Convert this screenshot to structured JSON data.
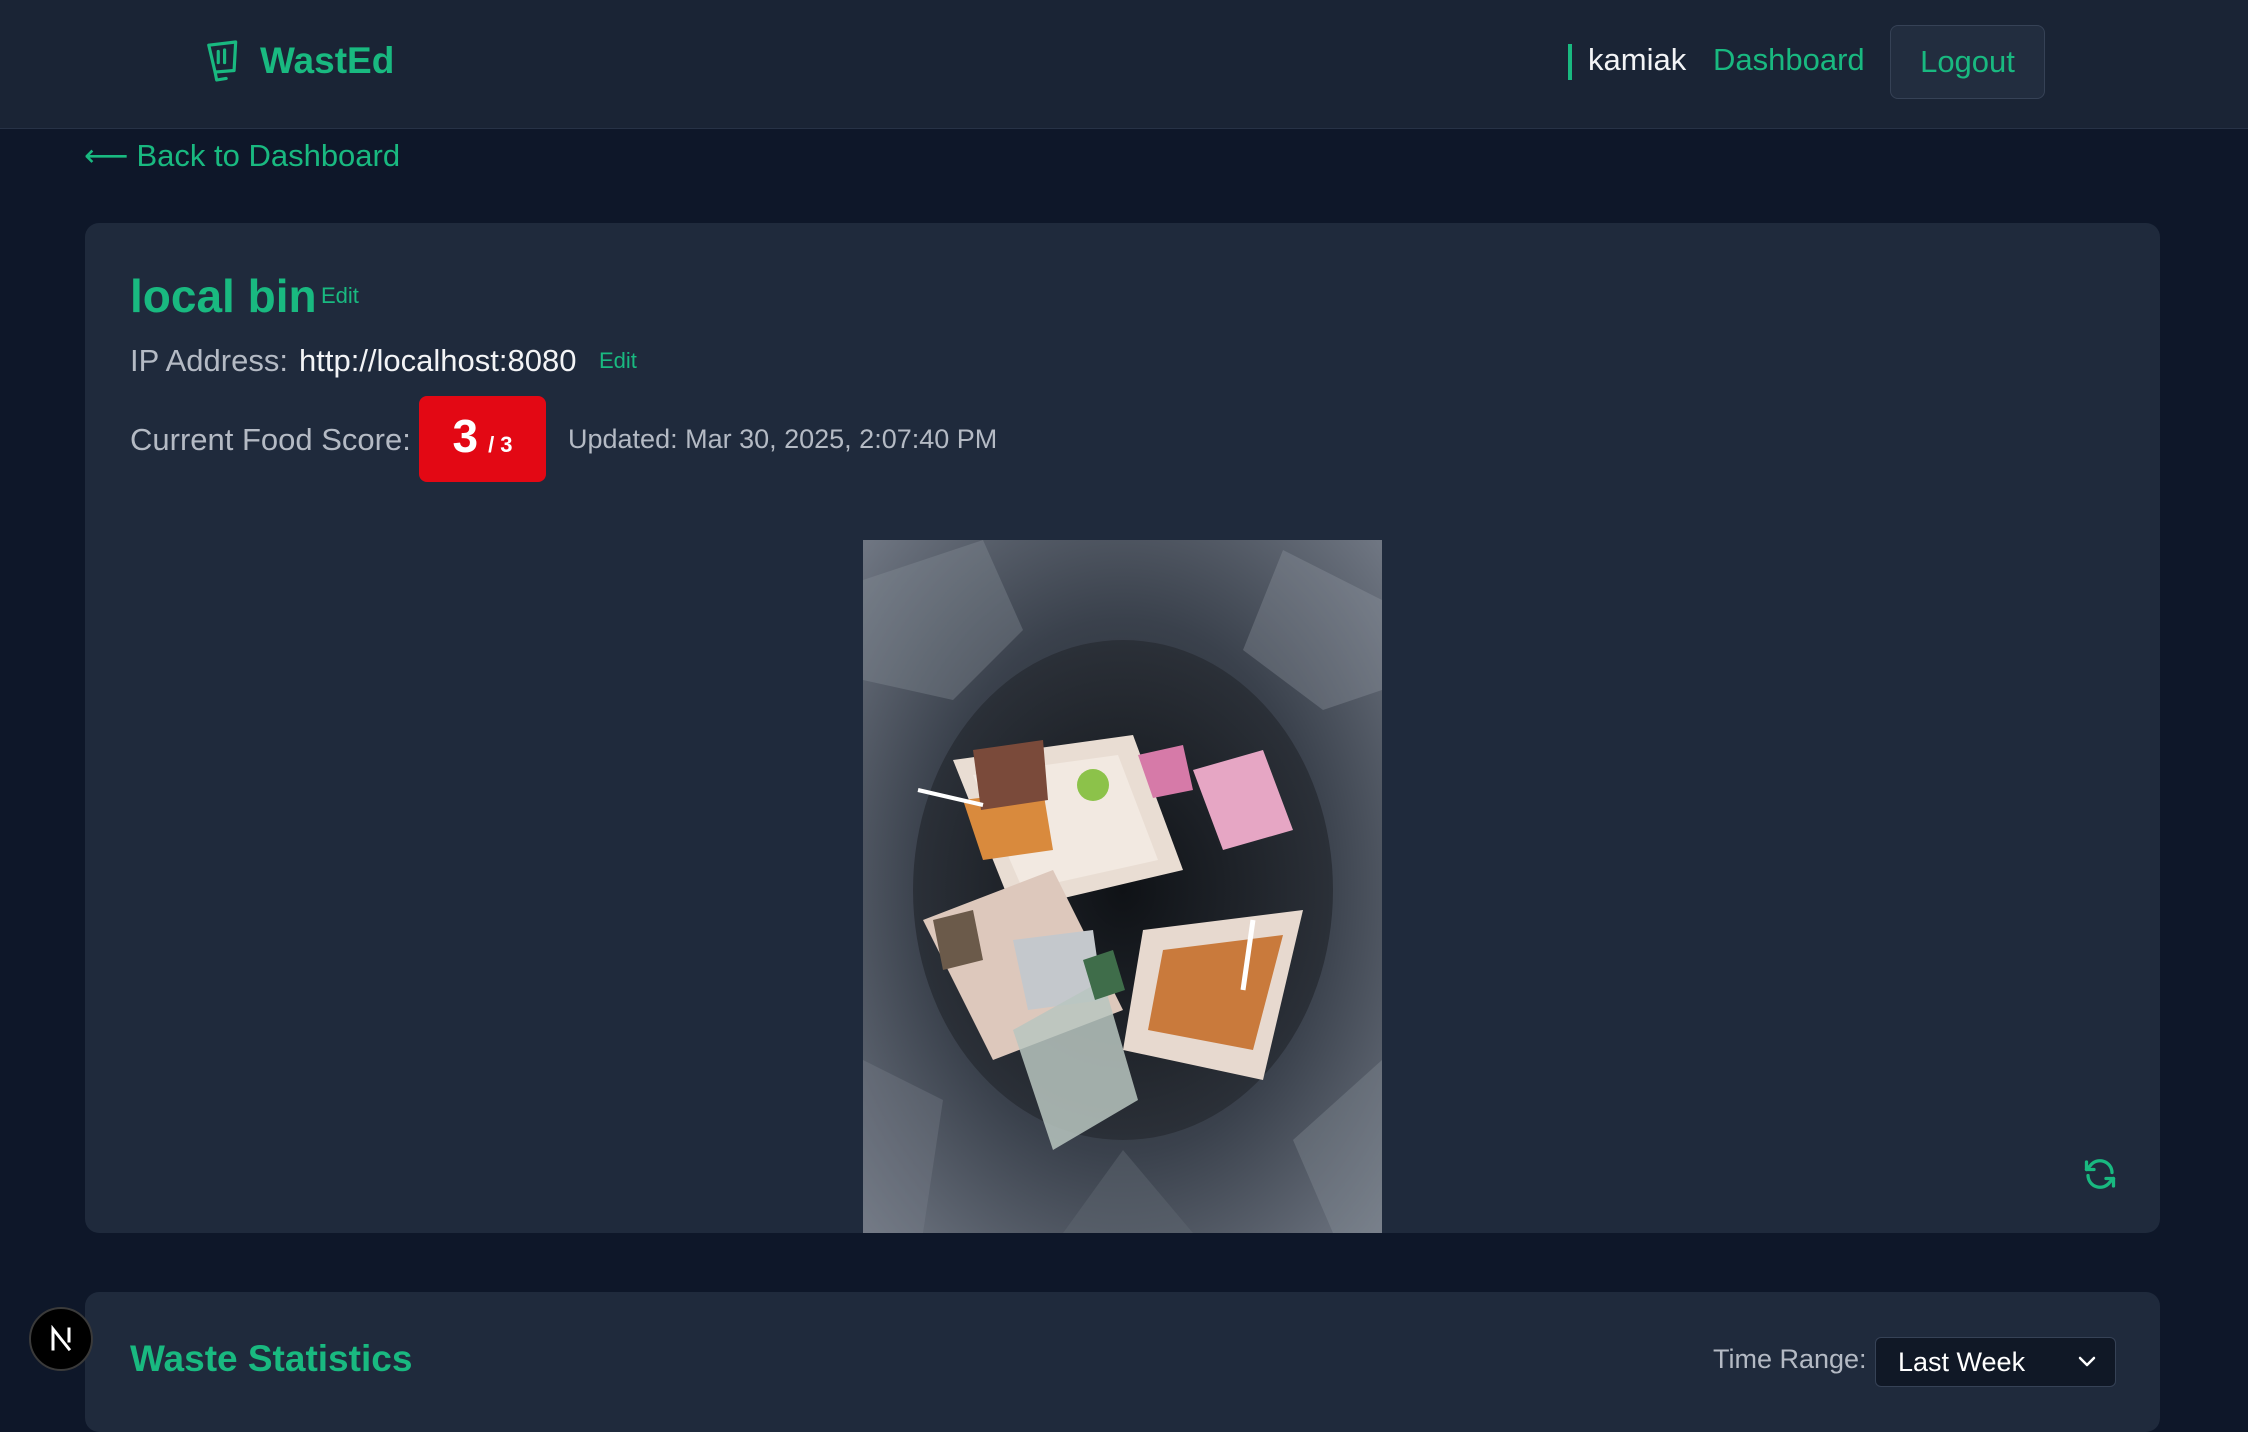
{
  "header": {
    "app_name": "WastEd",
    "username": "kamiak",
    "nav_dashboard": "Dashboard",
    "logout_label": "Logout",
    "accent": "#19b980"
  },
  "back_link": {
    "arrow": "⟵",
    "label": "Back to Dashboard"
  },
  "bin": {
    "name": "local bin",
    "edit_label": "Edit",
    "ip_label": "IP Address:",
    "ip_value": "http://localhost:8080",
    "ip_edit_label": "Edit",
    "score_label": "Current Food Score:",
    "score_value": "3",
    "score_max": "/ 3",
    "score_color": "#e30814",
    "updated": "Updated: Mar 30, 2025, 2:07:40 PM",
    "image_icon": "trash-bin-photo",
    "refresh_icon": "refresh-icon"
  },
  "stats": {
    "title": "Waste Statistics",
    "range_label": "Time Range:",
    "range_value": "Last Week"
  },
  "dev_badge": {
    "letter": "N"
  }
}
